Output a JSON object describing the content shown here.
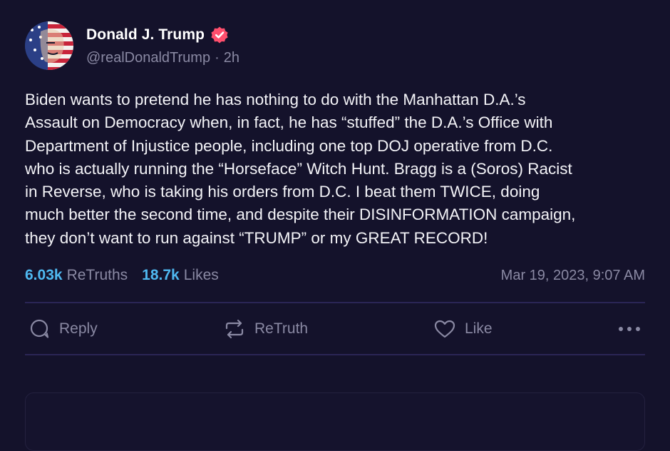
{
  "author": {
    "display_name": "Donald J. Trump",
    "handle": "@realDonaldTrump",
    "separator": "·",
    "time_ago": "2h",
    "verified": true,
    "verified_color": "#ff4f6d",
    "avatar": "avatar-portrait-flag"
  },
  "post": {
    "text": "Biden wants to pretend he has nothing to do with the Manhattan D.A.’s\nAssault on Democracy when, in fact, he has “stuffed” the D.A.’s Office with\nDepartment of Injustice people, including one top DOJ operative from D.C.\nwho is actually running the “Horseface” Witch Hunt. Bragg is a (Soros) Racist\nin Reverse, who is taking his orders from D.C. I beat them TWICE, doing\nmuch better the second time, and despite their DISINFORMATION campaign,\nthey don’t want to run against “TRUMP” or my GREAT RECORD!"
  },
  "stats": {
    "retruths_count": "6.03k",
    "retruths_label": "ReTruths",
    "likes_count": "18.7k",
    "likes_label": "Likes",
    "timestamp": "Mar 19, 2023, 9:07 AM",
    "count_color": "#4fb8f0"
  },
  "actions": {
    "reply_label": "Reply",
    "retruth_label": "ReTruth",
    "like_label": "Like",
    "reply_icon": "speech-bubble-icon",
    "retruth_icon": "repost-arrows-icon",
    "like_icon": "heart-icon",
    "more_icon": "ellipsis-icon"
  },
  "colors": {
    "background": "#14122b",
    "muted_text": "#8a89a3",
    "divider": "#2a2555"
  }
}
